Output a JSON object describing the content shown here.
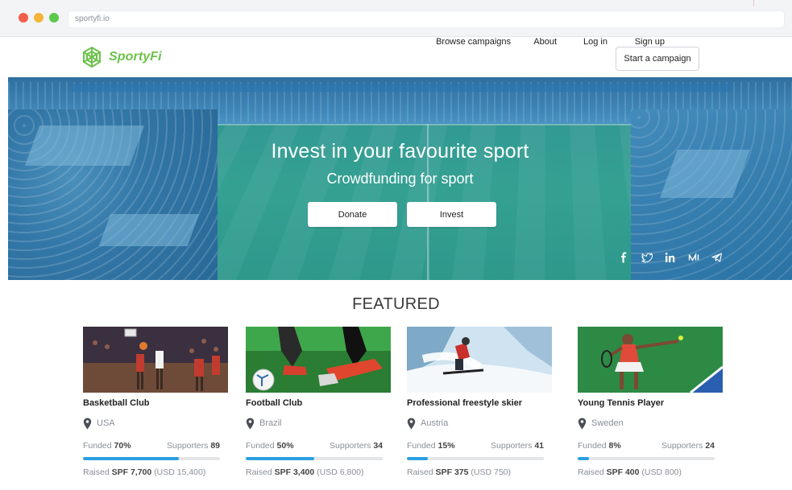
{
  "browser": {
    "address": "sportyfi.io"
  },
  "nav": {
    "logo_text": "SportyFi",
    "links": [
      "Browse campaigns",
      "About",
      "Log in",
      "Sign up"
    ],
    "cta": "Start a campaign"
  },
  "hero": {
    "title": "Invest in your favourite sport",
    "subtitle": "Crowdfunding for sport",
    "donate": "Donate",
    "invest": "Invest",
    "socials": [
      "facebook-icon",
      "twitter-icon",
      "linkedin-icon",
      "medium-icon",
      "telegram-icon"
    ]
  },
  "featured": {
    "title": "FEATURED",
    "cards": [
      {
        "name": "Basketball Club",
        "location": "USA",
        "funded_label": "Funded",
        "funded": "70%",
        "supporters_label": "Supporters",
        "supporters": "89",
        "raised_label": "Raised",
        "raised_spf": "SPF 7,700",
        "raised_usd": "(USD 15,400)",
        "progress": 0.7,
        "image": "basketball"
      },
      {
        "name": "Football Club",
        "location": "Brazil",
        "funded_label": "Funded",
        "funded": "50%",
        "supporters_label": "Supporters",
        "supporters": "34",
        "raised_label": "Raised",
        "raised_spf": "SPF 3,400",
        "raised_usd": "(USD 6,800)",
        "progress": 0.5,
        "image": "football"
      },
      {
        "name": "Professional freestyle skier",
        "location": "Austria",
        "funded_label": "Funded",
        "funded": "15%",
        "supporters_label": "Supporters",
        "supporters": "41",
        "raised_label": "Raised",
        "raised_spf": "SPF 375",
        "raised_usd": "(USD 750)",
        "progress": 0.15,
        "image": "ski"
      },
      {
        "name": "Young Tennis Player",
        "location": "Sweden",
        "funded_label": "Funded",
        "funded": "8%",
        "supporters_label": "Supporters",
        "supporters": "24",
        "raised_label": "Raised",
        "raised_spf": "SPF 400",
        "raised_usd": "(USD 800)",
        "progress": 0.08,
        "image": "tennis"
      }
    ]
  },
  "colors": {
    "brand_green": "#6cc24a",
    "progress_blue": "#2a9fe0"
  }
}
